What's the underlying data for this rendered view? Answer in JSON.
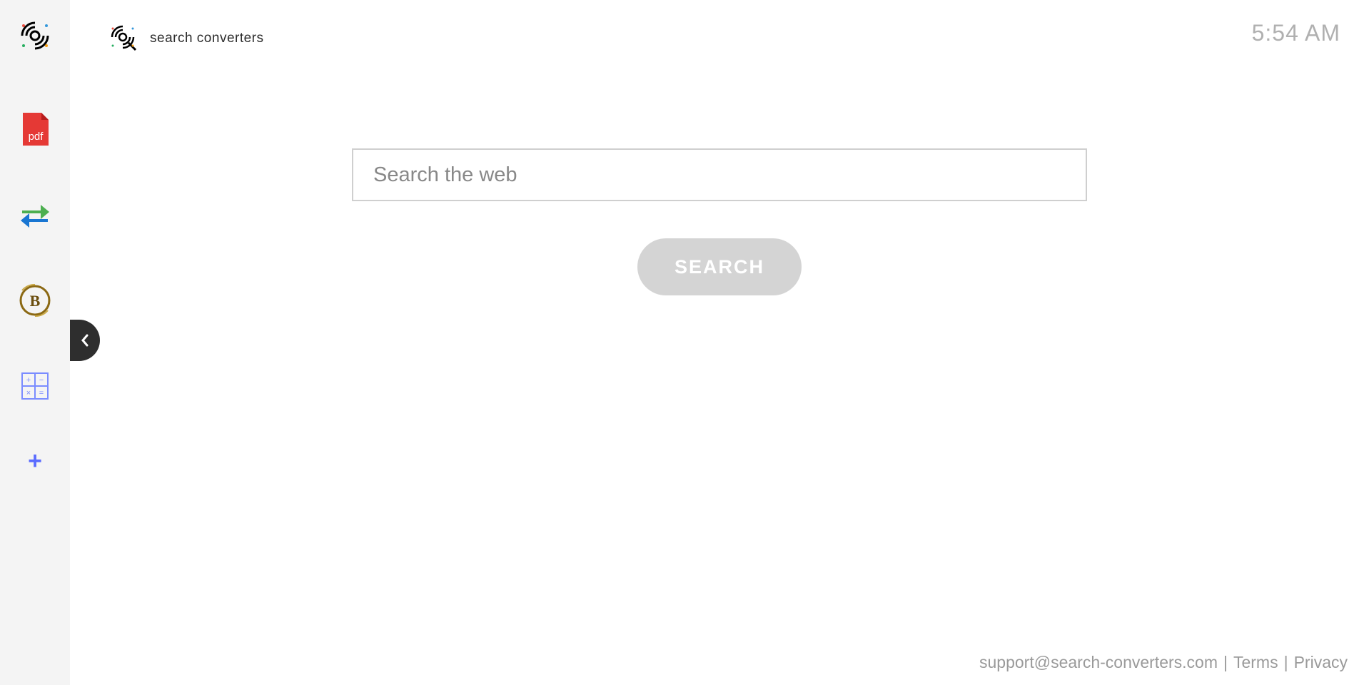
{
  "header": {
    "title": "search converters",
    "clock": "5:54 AM"
  },
  "search": {
    "placeholder": "Search the web",
    "button_label": "SEARCH"
  },
  "sidebar": {
    "items": [
      "logo",
      "pdf",
      "convert",
      "bitcoin",
      "calculator",
      "add"
    ]
  },
  "footer": {
    "email": "support@search-converters.com",
    "terms": "Terms",
    "privacy": "Privacy"
  }
}
